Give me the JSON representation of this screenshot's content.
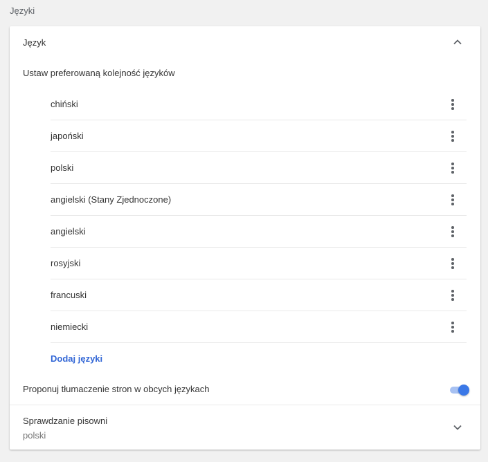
{
  "section_title": "Języki",
  "language_card": {
    "header_label": "Język",
    "collapse_icon": "chevron-up-icon",
    "subtitle": "Ustaw preferowaną kolejność języków",
    "languages": [
      {
        "name": "chiński"
      },
      {
        "name": "japoński"
      },
      {
        "name": "polski"
      },
      {
        "name": "angielski (Stany Zjednoczone)"
      },
      {
        "name": "angielski"
      },
      {
        "name": "rosyjski"
      },
      {
        "name": "francuski"
      },
      {
        "name": "niemiecki"
      }
    ],
    "more_icon": "more-vert-icon",
    "add_languages_label": "Dodaj języki",
    "translate_label": "Proponuj tłumaczenie stron w obcych językach",
    "translate_enabled": true
  },
  "spellcheck": {
    "label": "Sprawdzanie pisowni",
    "value": "polski",
    "expand_icon": "chevron-down-icon"
  },
  "colors": {
    "page_bg": "#f1f1f1",
    "card_bg": "#ffffff",
    "link": "#3367d6",
    "toggle_knob": "#3b78e7",
    "toggle_track": "#a7c1f2",
    "text": "#333333",
    "secondary_text": "#757575"
  }
}
